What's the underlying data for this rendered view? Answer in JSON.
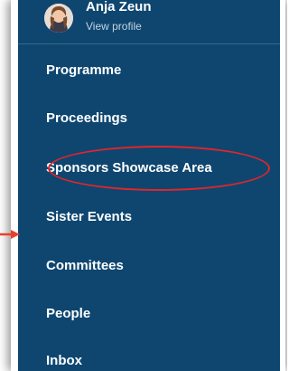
{
  "profile": {
    "name": "Anja Zeun",
    "link": "View profile"
  },
  "menu": {
    "items": [
      {
        "label": "Programme"
      },
      {
        "label": "Proceedings"
      },
      {
        "label": "Sponsors Showcase Area"
      },
      {
        "label": "Sister Events"
      },
      {
        "label": "Committees"
      },
      {
        "label": "People"
      },
      {
        "label": "Inbox"
      }
    ]
  },
  "colors": {
    "panel": "#0e4670",
    "highlight_ellipse": "#e0262b",
    "arrow": "#e8402a"
  },
  "icons": {
    "avatar": "user-photo",
    "pointer": "arrow-right-icon"
  }
}
